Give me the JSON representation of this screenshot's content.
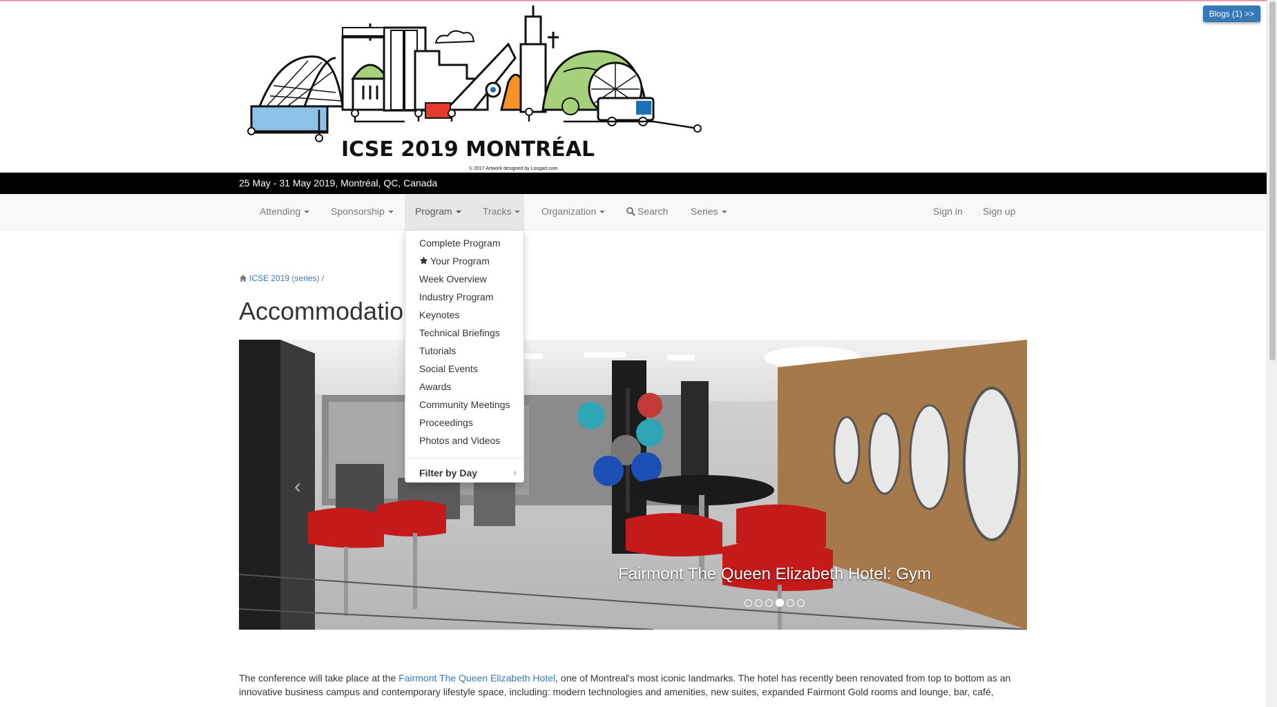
{
  "blogs_button": "Blogs (1) >>",
  "banner": {
    "title": "ICSE 2019 MONTRÉAL",
    "credit": "© 2017 Artwork designed by Loogart.com"
  },
  "date_line": "25 May - 31 May 2019, Montréal, QC, Canada",
  "nav": {
    "attending": "Attending",
    "sponsorship": "Sponsorship",
    "program": "Program",
    "tracks": "Tracks",
    "organization": "Organization",
    "search": "Search",
    "series": "Series",
    "sign_in": "Sign in",
    "sign_up": "Sign up"
  },
  "program_menu": {
    "items": [
      "Complete Program",
      "Your Program",
      "Week Overview",
      "Industry Program",
      "Keynotes",
      "Technical Briefings",
      "Tutorials",
      "Social Events",
      "Awards",
      "Community Meetings",
      "Proceedings",
      "Photos and Videos"
    ],
    "filter": "Filter by Day"
  },
  "breadcrumb": {
    "home": "ICSE 2019",
    "series": "series",
    "open": "(",
    "close": ")",
    "sep": "/"
  },
  "page_title": "Accommodation",
  "carousel": {
    "caption": "Fairmont The Queen Elizabeth Hotel: Gym",
    "slide_count": 6,
    "active_slide": 4
  },
  "body": {
    "pre": "The conference will take place at the ",
    "link": "Fairmont The Queen Elizabeth Hotel",
    "post": ", one of Montreal's most iconic landmarks. The hotel has recently been renovated from top to bottom as an innovative business campus and contemporary lifestyle space, including: modern technologies and amenities, new suites, expanded Fairmont Gold rooms and lounge, bar, café,"
  }
}
